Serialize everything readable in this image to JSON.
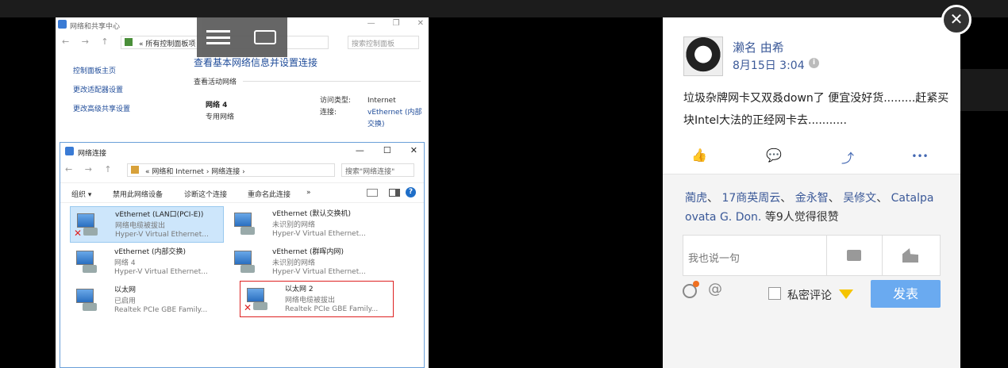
{
  "screenshot": {
    "window_title": "网络和共享中心",
    "win_buttons": [
      "—",
      "❐",
      "✕"
    ],
    "nav_arrows": "← → ↑",
    "path": "« 所有控制面板项",
    "search_placeholder": "搜索控制面板",
    "left_nav": [
      "控制面板主页",
      "更改适配器设置",
      "更改高级共享设置"
    ],
    "main_heading": "查看基本网络信息并设置连接",
    "active_networks_label": "查看活动网络",
    "network_name": "网络 4",
    "network_type": "专用网络",
    "access_type_label": "访问类型:",
    "connection_label": "连接:",
    "access_type_value": "Internet",
    "connection_value": "vEthernet (内部交换)"
  },
  "inner_window": {
    "title": "网络连接",
    "win_buttons": [
      "—",
      "☐",
      "✕"
    ],
    "nav_arrows": "← → ↑",
    "path": "« 网络和 Internet › 网络连接 ›",
    "search_placeholder": "搜索\"网络连接\"",
    "toolbar": [
      "组织 ▾",
      "禁用此网络设备",
      "诊断这个连接",
      "重命名此连接",
      "»"
    ],
    "help": "?",
    "items": [
      {
        "name": "vEthernet (LAN口(PCI-E))",
        "status": "网络电缆被拔出",
        "adapter": "Hyper-V Virtual Ethernet...",
        "x": "✕"
      },
      {
        "name": "vEthernet (默认交换机)",
        "status": "未识别的网络",
        "adapter": "Hyper-V Virtual Ethernet...",
        "x": ""
      },
      {
        "name": "vEthernet (内部交换)",
        "status": "网络 4",
        "adapter": "Hyper-V Virtual Ethernet...",
        "x": ""
      },
      {
        "name": "vEthernet (群晖内网)",
        "status": "未识别的网络",
        "adapter": "Hyper-V Virtual Ethernet...",
        "x": ""
      },
      {
        "name": "以太网",
        "status": "已启用",
        "adapter": "Realtek PCIe GBE Family...",
        "x": ""
      },
      {
        "name": "以太网 2",
        "status": "网络电缆被拔出",
        "adapter": "Realtek PCIe GBE Family...",
        "x": "✕"
      }
    ]
  },
  "post": {
    "author": "濑名 由希",
    "time": "8月15日 3:04",
    "info_icon": "i",
    "text": "垃圾杂牌网卡又双叒down了 便宜没好货.........赶紧买块Intel大法的正经网卡去...........",
    "action_icons": [
      "like-icon",
      "comment-icon",
      "share-icon",
      "more-icon"
    ],
    "action_glyphs": [
      "👍",
      "💬",
      "⤴",
      "•••"
    ]
  },
  "likes": {
    "names": [
      "蔺虎",
      "17商英周云",
      "金永智",
      "吴修文",
      "Catalpa ovata G. Don."
    ],
    "separator": "、",
    "suffix": " 等9人觉得很赞"
  },
  "comment": {
    "placeholder": "我也说一句",
    "at": "@",
    "private_label": "私密评论",
    "submit_label": "发表"
  },
  "close_glyph": "✕"
}
